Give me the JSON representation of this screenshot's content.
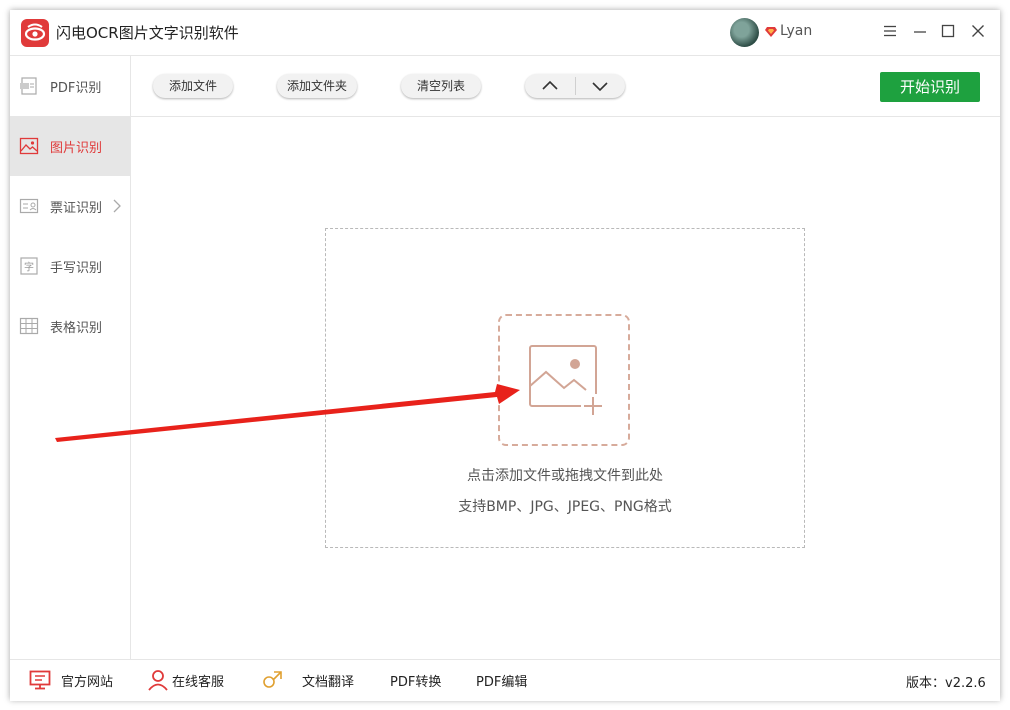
{
  "app": {
    "title": "闪电OCR图片文字识别软件",
    "username": "Lyan",
    "icons": {
      "logo": "eye-logo-icon",
      "vip": "diamond-vip-icon",
      "menu": "menu-icon",
      "minimize": "minimize-icon",
      "maximize": "maximize-icon",
      "close": "close-icon"
    },
    "accent_color": "#e03a3a",
    "start_color": "#1ea13f"
  },
  "sidebar": {
    "items": [
      {
        "label": "PDF识别",
        "icon": "pdf-doc-icon"
      },
      {
        "label": "图片识别",
        "icon": "image-icon"
      },
      {
        "label": "票证识别",
        "icon": "id-card-icon"
      },
      {
        "label": "手写识别",
        "icon": "handwriting-icon"
      },
      {
        "label": "表格识别",
        "icon": "table-icon"
      }
    ],
    "active_index": 1
  },
  "toolbar": {
    "add_file": "添加文件",
    "add_folder": "添加文件夹",
    "clear_list": "清空列表",
    "move_up_icon": "chevron-up-icon",
    "move_down_icon": "chevron-down-icon",
    "start": "开始识别"
  },
  "dropzone": {
    "icon": "add-image-icon",
    "line1": "点击添加文件或拖拽文件到此处",
    "line2": "支持BMP、JPG、JPEG、PNG格式"
  },
  "statusbar": {
    "website": "官方网站",
    "support": "在线客服",
    "translate": "文档翻译",
    "pdf_convert": "PDF转换",
    "pdf_edit": "PDF编辑",
    "version": "版本：v2.2.6"
  }
}
